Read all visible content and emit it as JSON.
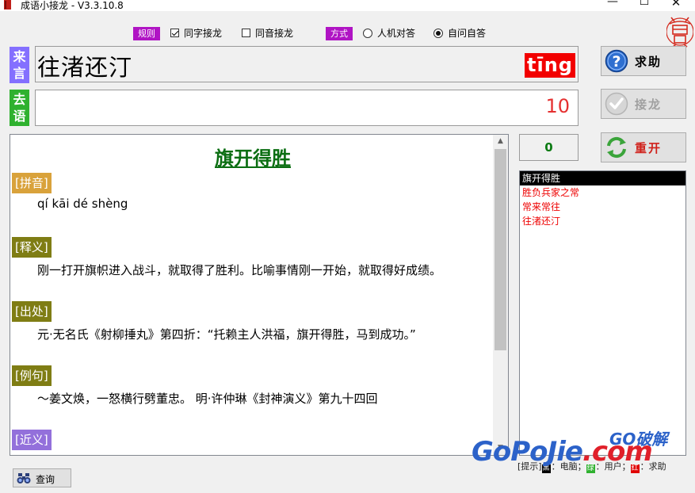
{
  "window": {
    "title": "成语小接龙 - V3.3.10.8",
    "minimize": "—",
    "maximize": "☐",
    "close": "✕"
  },
  "rules": {
    "rule_tag": "规则",
    "same_char": "同字接龙",
    "same_char_checked": true,
    "same_sound": "同音接龙",
    "same_sound_checked": false,
    "mode_tag": "方式",
    "vs_computer": "人机对答",
    "self_answer": "自问自答",
    "selected_mode": "self_answer"
  },
  "incoming": {
    "label": "来言",
    "text": "往渚还汀",
    "pinyin": "tīng"
  },
  "outgoing": {
    "label": "去语",
    "value": "",
    "count": "10"
  },
  "buttons": {
    "help": "求助",
    "next": "接龙",
    "restart": "重开",
    "query": "查询"
  },
  "counter": "0",
  "detail": {
    "title": "旗开得胜",
    "sections": [
      {
        "label": "[拼音]",
        "text": "qí kāi dé shèng"
      },
      {
        "label": "[释义]",
        "text": "刚一打开旗帜进入战斗，就取得了胜利。比喻事情刚一开始，就取得好成绩。"
      },
      {
        "label": "[出处]",
        "text": "元·无名氏《射柳捶丸》第四折：“托赖主人洪福，旗开得胜，马到成功。”"
      },
      {
        "label": "[例句]",
        "text": "～姜文焕，一怒横行劈董忠。 明·许仲琳《封神演义》第九十四回"
      },
      {
        "label": "[近义]",
        "text": ""
      }
    ]
  },
  "history": [
    "旗开得胜",
    "胜负兵家之常",
    "常来常往",
    "往渚还汀"
  ],
  "legend": {
    "prefix": "[提示]",
    "black": "黑",
    "computer": "：电脑；",
    "green": "绿",
    "user": "：用户；",
    "red": "红",
    "help": "：求助",
    "colors": {
      "black": "#000000",
      "green": "#2fb12f",
      "red": "#e00000"
    }
  },
  "watermark": {
    "top": "GO破解",
    "main_a": "GoPoJie",
    "main_b": ".com"
  },
  "colors": {
    "purple_tag": "#b014c4",
    "lai_label": "#8470ff",
    "qu_label": "#2fb12f",
    "pinyin_badge": "#f20000",
    "title_green": "#0b6e12"
  }
}
